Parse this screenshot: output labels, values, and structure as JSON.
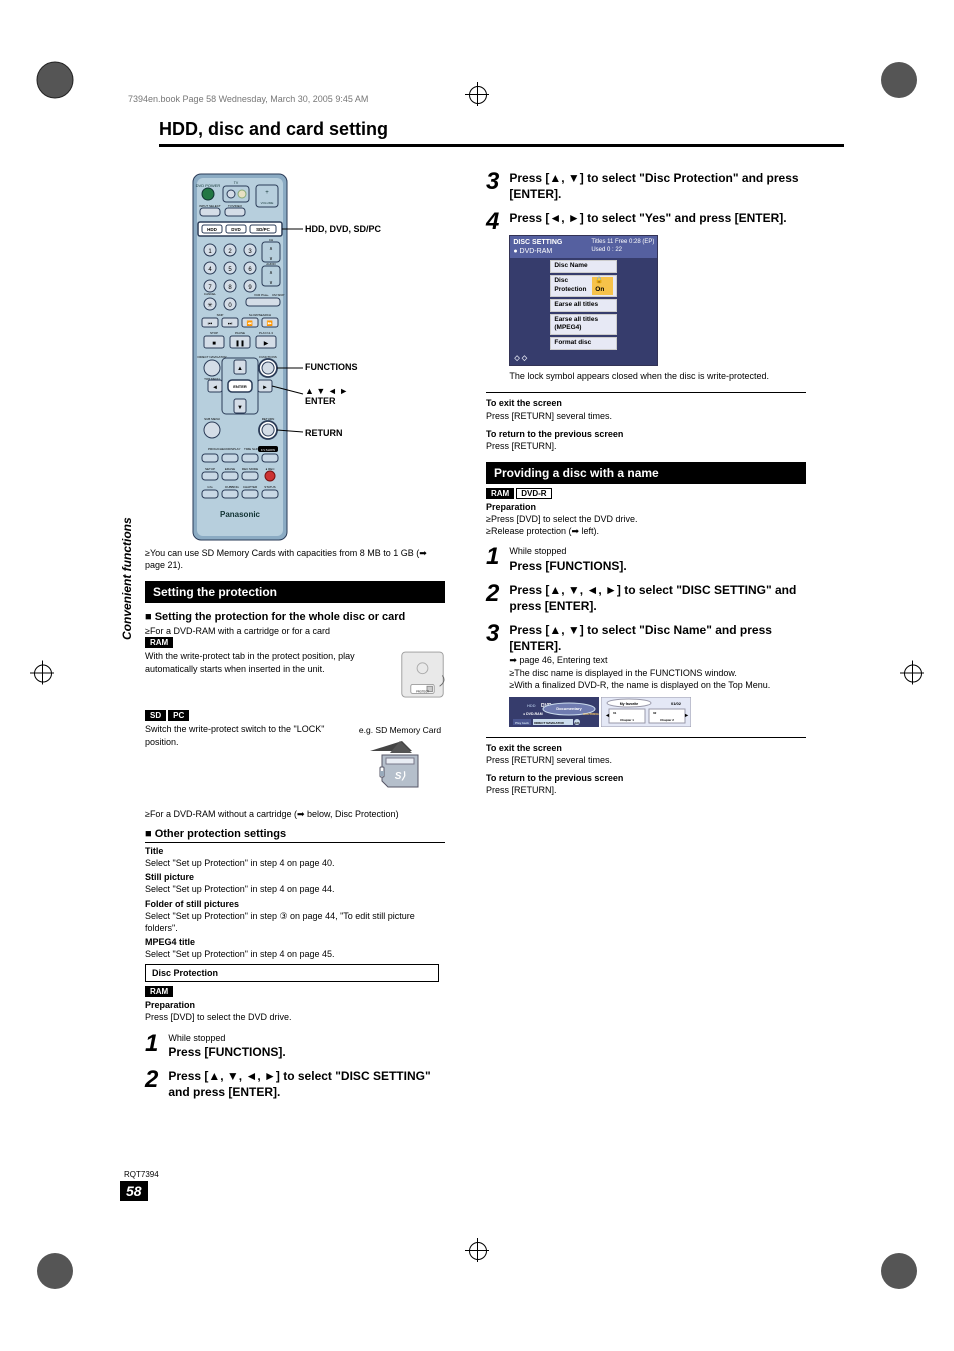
{
  "topline": "7394en.book  Page 58  Wednesday, March 30, 2005  9:45 AM",
  "page_title": "HDD, disc and card setting",
  "sidecaption": "Convenient functions",
  "rqt": "RQT7394",
  "page_number": "58",
  "remote": {
    "labels": {
      "hd_dvd_sdpc": "HDD, DVD, SD/PC",
      "functions": "FUNCTIONS",
      "arrows_enter": "▲ ▼ ◄ ►\nENTER",
      "return": "RETURN"
    },
    "brand": "Panasonic"
  },
  "left": {
    "sd_note": "≥You can use SD Memory Cards with capacities from 8 MB to 1 GB (➡ page 21).",
    "bar1": "Setting the protection",
    "sub1": "■ Setting the protection for the whole disc or card",
    "sub1_bullet": "≥For a DVD-RAM with a cartridge or for a card",
    "badges1": "RAM",
    "ram_body": "With the write-protect tab in the protect position, play automatically starts when inserted in the unit.",
    "badges2a": "SD",
    "badges2b": "PC",
    "sd_body": "Switch the write-protect switch to the \"LOCK\" position.",
    "sd_caption": "e.g. SD Memory Card",
    "b_cartridge": "≥For a DVD-RAM without a cartridge (➡ below, Disc Protection)",
    "sub2": "■ Other protection settings",
    "t_title": "Title",
    "t_title_b": "Select \"Set up Protection\" in step 4 on page 40.",
    "t_still": "Still picture",
    "t_still_b": "Select \"Set up Protection\" in step 4 on page 44.",
    "t_folder": "Folder of still pictures",
    "t_folder_b": "Select \"Set up Protection\" in step ③ on page 44, \"To edit still picture folders\".",
    "t_mpeg": "MPEG4 title",
    "t_mpeg_b": "Select \"Set up Protection\" in step 4 on page 45.",
    "discprot_box": "Disc Protection",
    "ram2": "RAM",
    "prep": "Preparation",
    "prep_body": "Press [DVD] to select the DVD drive.",
    "step1_small": "While stopped",
    "step1": "Press [FUNCTIONS].",
    "step2": "Press [▲, ▼, ◄, ►] to select \"DISC SETTING\" and press [ENTER]."
  },
  "right": {
    "step3": "Press [▲, ▼] to select \"Disc Protection\" and press [ENTER].",
    "step4": "Press [◄, ►] to select \"Yes\" and press [ENTER].",
    "discbox": {
      "hdr_l": "DISC SETTING",
      "hdr_r": "Titles 11    Free 0:28 (EP)",
      "hdr_sub": "● DVD-RAM",
      "hdr_used": "Used   0 : 22",
      "r1": "Disc Name",
      "r2": "Disc Protection",
      "r2_on": "🔒 On",
      "r3": "Earse all titles",
      "r4": "Earse all titles (MPEG4)",
      "r5": "Format disc"
    },
    "lock_note": "The lock symbol appears closed when the disc is write-protected.",
    "exit_h": "To exit the screen",
    "exit_b": "Press [RETURN] several times.",
    "prev_h": "To return to the previous screen",
    "prev_b": "Press [RETURN].",
    "bar2": "Providing a disc with a name",
    "badges": {
      "a": "RAM",
      "b": "DVD-R"
    },
    "prep": "Preparation",
    "prep_b1": "≥Press [DVD] to select the DVD drive.",
    "prep_b2": "≥Release protection (➡ left).",
    "step1_small": "While stopped",
    "step1": "Press [FUNCTIONS].",
    "step2": "Press [▲, ▼, ◄, ►] to select \"DISC SETTING\" and press [ENTER].",
    "step3b": "Press [▲, ▼] to select \"Disc Name\" and press [ENTER].",
    "step3_small": "➡ page 46, Entering text",
    "bul1": "≥The disc name is displayed in the FUNCTIONS window.",
    "bul2": "≥With a finalized DVD-R, the name is displayed on the Top Menu.",
    "exit2_h": "To exit the screen",
    "exit2_b": "Press [RETURN] several times.",
    "prev2_h": "To return to the previous screen",
    "prev2_b": "Press [RETURN]."
  }
}
